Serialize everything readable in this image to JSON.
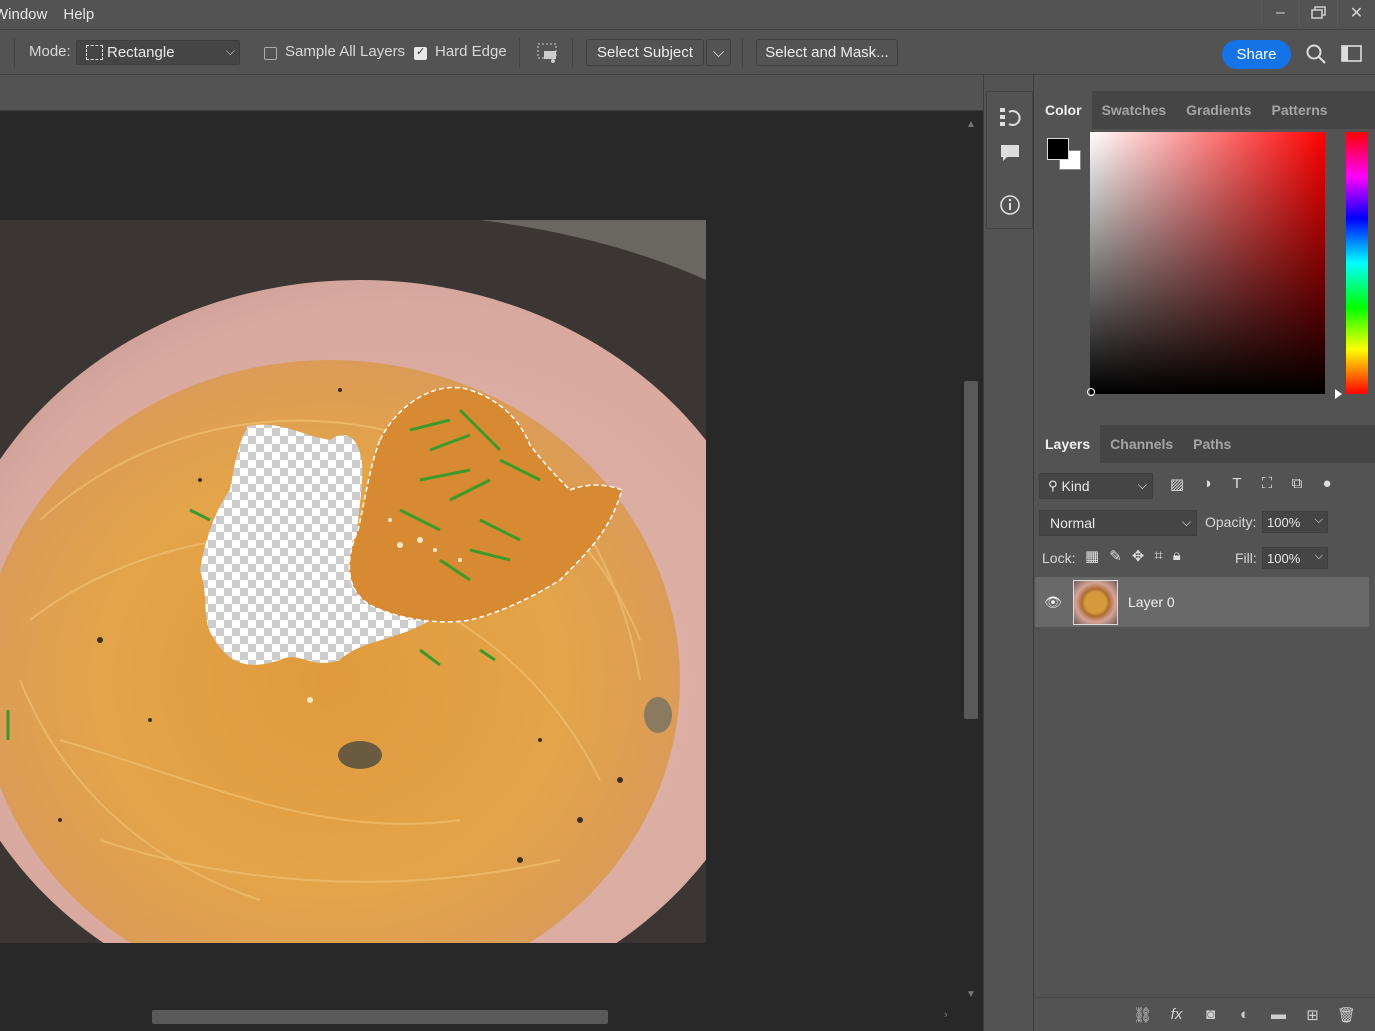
{
  "menubar": {
    "items": [
      "Window",
      "Help"
    ],
    "window_controls": [
      "minimize",
      "restore",
      "close"
    ]
  },
  "options": {
    "mode_label": "Mode:",
    "mode_value": "Rectangle",
    "sample_all_layers": {
      "label": "Sample All Layers",
      "checked": false
    },
    "hard_edge": {
      "label": "Hard Edge",
      "checked": true
    },
    "select_subject": "Select Subject",
    "select_and_mask": "Select and Mask...",
    "share": "Share"
  },
  "color_panel": {
    "tabs": [
      "Color",
      "Swatches",
      "Gradients",
      "Patterns"
    ],
    "active_tab": "Color",
    "foreground": "#000000",
    "background": "#ffffff",
    "hue": "#ff0000"
  },
  "layers_panel": {
    "tabs": [
      "Layers",
      "Channels",
      "Paths"
    ],
    "active_tab": "Layers",
    "filter": "Kind",
    "blend_mode": "Normal",
    "opacity_label": "Opacity:",
    "opacity": "100%",
    "lock_label": "Lock:",
    "fill_label": "Fill:",
    "fill": "100%",
    "layers": [
      {
        "name": "Layer 0",
        "visible": true
      }
    ]
  },
  "icons": {
    "kind_filters": [
      "image-filter-icon",
      "adjustment-filter-icon",
      "type-filter-icon",
      "shape-filter-icon",
      "smart-object-filter-icon"
    ],
    "locks": [
      "lock-transparent-icon",
      "lock-image-icon",
      "lock-position-icon",
      "lock-artboard-icon",
      "lock-all-icon"
    ],
    "bottom": [
      "link-icon",
      "fx-icon",
      "mask-icon",
      "adjustment-icon",
      "group-icon",
      "new-layer-icon",
      "trash-icon"
    ]
  },
  "labels": {
    "fx": "fx"
  }
}
